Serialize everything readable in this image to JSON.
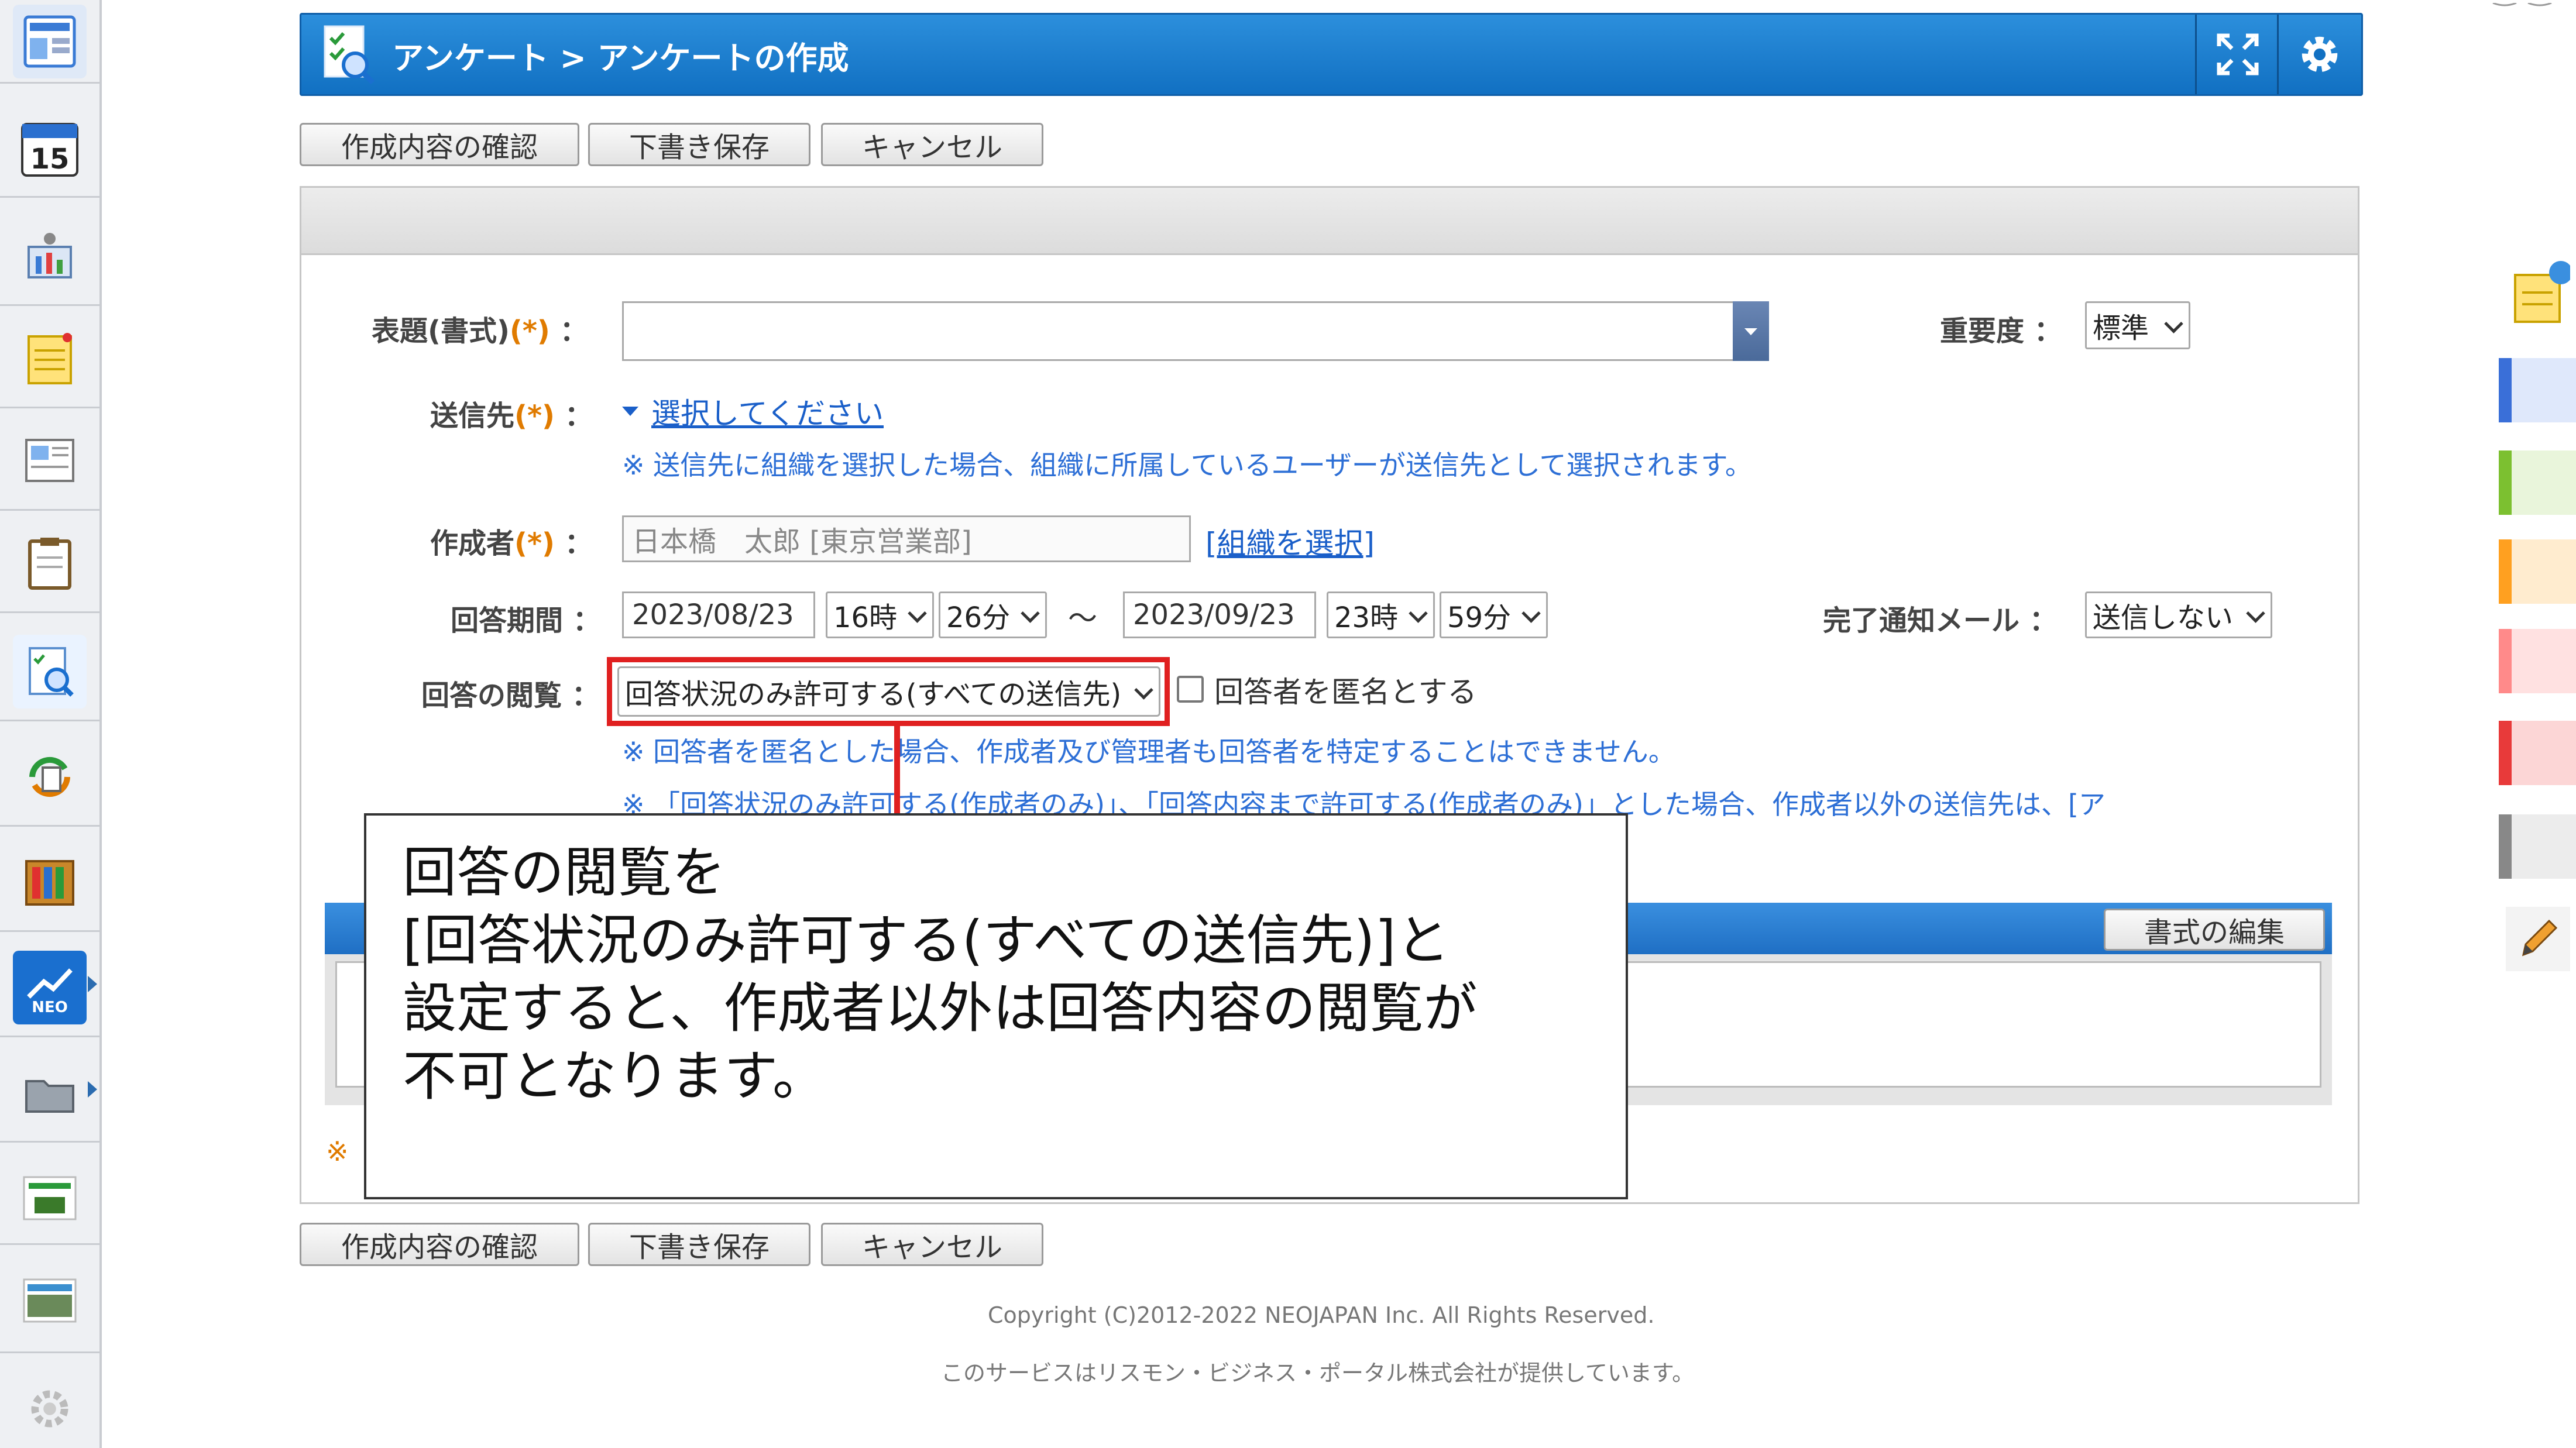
{
  "header": {
    "title": "アンケート > アンケートの作成"
  },
  "toolbar": {
    "confirm_label": "作成内容の確認",
    "draft_label": "下書き保存",
    "cancel_label": "キャンセル"
  },
  "form": {
    "subject_label": "表題(書式)",
    "required_mark": "(*)",
    "colon": "：",
    "importance_label": "重要度",
    "importance_value": "標準",
    "recipients_label": "送信先",
    "recipients_link": "選択してください",
    "recipients_note": "※ 送信先に組織を選択した場合、組織に所属しているユーザーが送信先として選択されます。",
    "author_label": "作成者",
    "author_value": "日本橋　太郎 [東京営業部]",
    "author_org_link": "[組織を選択]",
    "period_label": "回答期間",
    "start_date": "2023/08/23",
    "start_hour": "16時",
    "start_min": "26分",
    "tilde": "～",
    "end_date": "2023/09/23",
    "end_hour": "23時",
    "end_min": "59分",
    "mail_label": "完了通知メール",
    "mail_value": "送信しない",
    "view_label": "回答の閲覧",
    "view_value": "回答状況のみ許可する(すべての送信先)",
    "anonymous_label": "回答者を匿名とする",
    "view_note1": "※ 回答者を匿名とした場合、作成者及び管理者も回答者を特定することはできません。",
    "view_note2": "※ 「回答状況のみ許可する(作成者のみ)」、「回答内容まで許可する(作成者のみ)」とした場合、作成者以外の送信先は、[ア",
    "edit_format_label": "書式の編集",
    "asterisk": "※"
  },
  "callout": {
    "line1": "回答の閲覧を",
    "line2": "[回答状況のみ許可する(すべての送信先)]と",
    "line3": "設定すると、作成者以外は回答内容の閲覧が",
    "line4": "不可となります。"
  },
  "footer": {
    "copyright": "Copyright (C)2012-2022 NEOJAPAN Inc. All Rights Reserved.",
    "service": "このサービスはリスモン・ビジネス・ポータル株式会社が提供しています。"
  },
  "sidebar": {
    "calendar_day": "15",
    "neo_label": "NEO"
  },
  "colors": {
    "header": "#1a7fd0",
    "highlight": "#e02020",
    "note": "#2d6fd6"
  }
}
